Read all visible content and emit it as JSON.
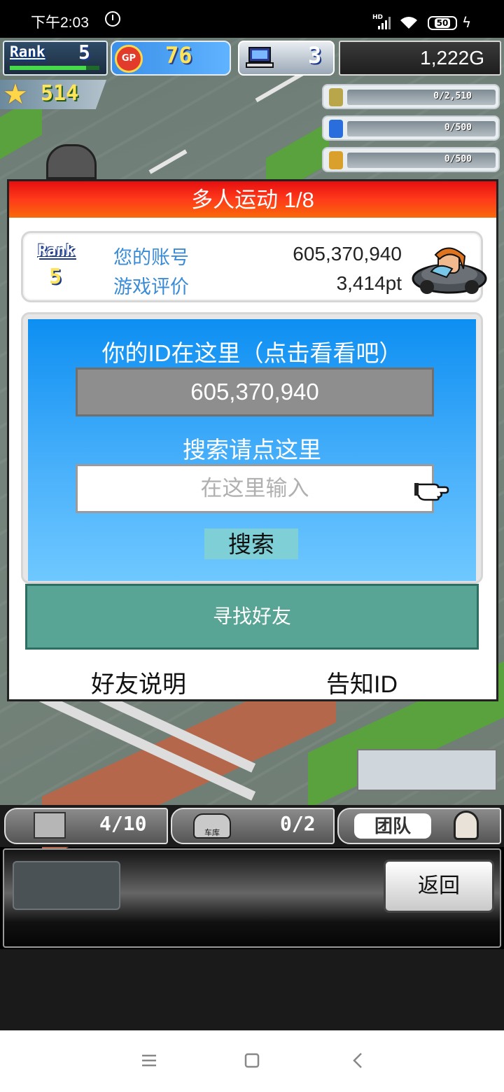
{
  "status_bar": {
    "time": "下午2:03",
    "hd": "HD",
    "battery": "50"
  },
  "hud": {
    "rank_label": "Rank",
    "rank_value": "5",
    "rank_progress": 0.85,
    "gp_icon_text": "GP",
    "gp_value": "76",
    "pc_value": "3",
    "money": "1,222G",
    "star_value": "514",
    "resources": [
      {
        "icon": "coin-stack-icon",
        "text": "0/2,510"
      },
      {
        "icon": "blue-fuel-icon",
        "text": "0/500"
      },
      {
        "icon": "wheat-icon",
        "text": "0/500"
      }
    ]
  },
  "dialog": {
    "title": "多人运动 1/8",
    "rank_label": "Rank",
    "rank_value": "5",
    "account_label": "您的账号",
    "account_value": "605,370,940",
    "rating_label": "游戏评价",
    "rating_value": "3,414pt",
    "id_caption": "你的ID在这里（点击看看吧）",
    "id_value": "605,370,940",
    "search_caption": "搜索请点这里",
    "search_placeholder": "在这里输入",
    "search_button": "搜索",
    "find_friends_button": "寻找好友",
    "friend_help_link": "好友说明",
    "share_id_link": "告知ID"
  },
  "bottom": {
    "tab1_value": "4/10",
    "tab2_label": "车库",
    "tab2_value": "0/2",
    "tab3_label": "团队",
    "back_button": "返回"
  },
  "colors": {
    "title_red": "#e61010",
    "panel_blue": "#0d8ff2",
    "friend_green": "#58a595"
  }
}
